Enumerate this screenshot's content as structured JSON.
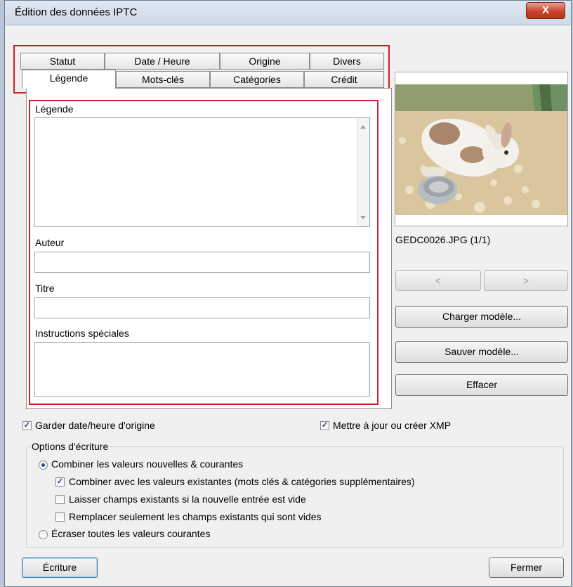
{
  "window": {
    "title": "Édition des données IPTC",
    "close_glyph": "X"
  },
  "tabs": {
    "row1": [
      "Statut",
      "Date / Heure",
      "Origine",
      "Divers"
    ],
    "row2": [
      "Légende",
      "Mots-clés",
      "Catégories",
      "Crédit"
    ],
    "active": "Légende"
  },
  "form": {
    "legende_label": "Légende",
    "legende_value": "",
    "auteur_label": "Auteur",
    "auteur_value": "",
    "titre_label": "Titre",
    "titre_value": "",
    "instructions_label": "Instructions spéciales",
    "instructions_value": ""
  },
  "preview": {
    "filename": "GEDC0026.JPG (1/1)",
    "prev_label": "<",
    "next_label": ">"
  },
  "buttons": {
    "load_template": "Charger modèle...",
    "save_template": "Sauver modèle...",
    "clear": "Effacer",
    "write": "Écriture",
    "close": "Fermer"
  },
  "checkboxes": {
    "keep_date": {
      "label": "Garder date/heure d'origine",
      "checked": true
    },
    "update_xmp": {
      "label": "Mettre à jour ou créer XMP",
      "checked": true
    }
  },
  "write_options": {
    "group_label": "Options d'écriture",
    "combine_radio": {
      "label": "Combiner les valeurs nouvelles & courantes",
      "selected": true
    },
    "combine_existing": {
      "label": "Combiner avec les valeurs existantes (mots clés & catégories supplémentaires)",
      "checked": true
    },
    "keep_existing_if_empty": {
      "label": "Laisser champs existants si la nouvelle entrée est vide",
      "checked": false
    },
    "replace_only_empty": {
      "label": "Remplacer seulement les champs existants qui sont vides",
      "checked": false
    },
    "overwrite_radio": {
      "label": "Écraser toutes les valeurs courantes",
      "selected": false
    }
  },
  "colors": {
    "highlight": "#cc1f2a",
    "accent": "#1b4e9b"
  }
}
